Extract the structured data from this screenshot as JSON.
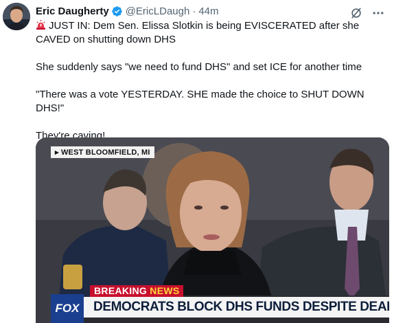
{
  "author": {
    "name": "Eric Daugherty",
    "handle": "@EricLDaugh",
    "separator": "·",
    "time": "44m"
  },
  "icons": {
    "verified": "verified-badge-icon",
    "grok": "grok-icon",
    "more": "more-icon",
    "siren": "siren-emoji-icon"
  },
  "colors": {
    "verified": "#1d9bf0",
    "breaking_red": "#c8102e",
    "fox_blue": "#1b3f8f"
  },
  "tweet": {
    "line1": "JUST IN: Dem Sen. Elissa Slotkin is being EVISCERATED after she CAVED on shutting down DHS",
    "line2": "She suddenly says \"we need to fund DHS\" and set ICE for another time",
    "line3": "\"There was a vote YESTERDAY. SHE made the choice to SHUT DOWN DHS!\"",
    "line4": "They're caving!"
  },
  "video": {
    "location": "▸ WEST BLOOMFIELD, MI",
    "breaking": "BREAKING",
    "news": "NEWS",
    "chyron": "DEMOCRATS BLOCK DHS FUNDS DESPITE DEADLY ATTACKS",
    "network": "FOX"
  }
}
